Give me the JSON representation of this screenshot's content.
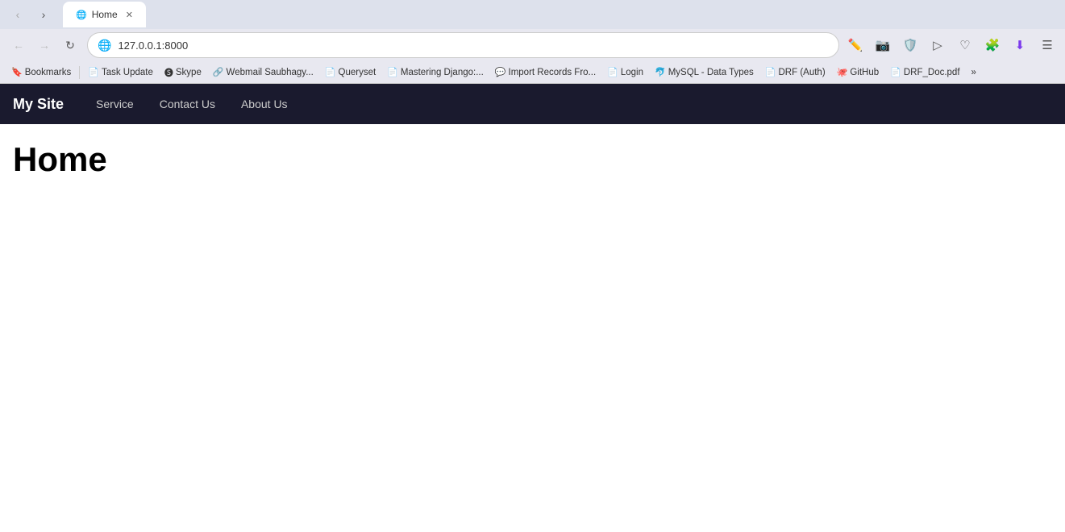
{
  "browser": {
    "tab_title": "Home",
    "tab_favicon": "🌐",
    "address": "127.0.0.1:8000",
    "back_btn": "←",
    "forward_btn": "→",
    "reload_btn": "↻",
    "menu_btn": "⋮"
  },
  "bookmarks": [
    {
      "label": "Bookmarks",
      "icon": "🔖",
      "id": "bookmarks"
    },
    {
      "label": "Task Update",
      "icon": "📄",
      "id": "task-update"
    },
    {
      "label": "Skype",
      "icon": "🅢",
      "id": "skype",
      "brand": true
    },
    {
      "label": "Webmail Saubhagy...",
      "icon": "🔗",
      "id": "webmail"
    },
    {
      "label": "Queryset",
      "icon": "📄",
      "id": "queryset"
    },
    {
      "label": "Mastering Django:...",
      "icon": "📄",
      "id": "mastering-django"
    },
    {
      "label": "Import Records Fro...",
      "icon": "💬",
      "id": "import-records"
    },
    {
      "label": "Login",
      "icon": "📄",
      "id": "login"
    },
    {
      "label": "MySQL - Data Types",
      "icon": "🐬",
      "id": "mysql"
    },
    {
      "label": "DRF (Auth)",
      "icon": "📄",
      "id": "drf-auth"
    },
    {
      "label": "GitHub",
      "icon": "🐙",
      "id": "github"
    },
    {
      "label": "DRF_Doc.pdf",
      "icon": "📄",
      "id": "drf-doc"
    },
    {
      "label": "»",
      "icon": "",
      "id": "more"
    }
  ],
  "toolbar_icons": [
    {
      "icon": "✏️",
      "name": "screenshot-icon"
    },
    {
      "icon": "📷",
      "name": "camera-icon"
    },
    {
      "icon": "🛡️",
      "name": "shield-icon",
      "color": "purple"
    },
    {
      "icon": "▷",
      "name": "play-icon"
    },
    {
      "icon": "♡",
      "name": "heart-icon"
    },
    {
      "icon": "🧩",
      "name": "puzzle-icon"
    },
    {
      "icon": "⬇️",
      "name": "download-icon",
      "color": "purple"
    },
    {
      "icon": "☰",
      "name": "menu-icon"
    }
  ],
  "site": {
    "logo": "My Site",
    "nav_links": [
      {
        "label": "Service",
        "id": "nav-service"
      },
      {
        "label": "Contact Us",
        "id": "nav-contact"
      },
      {
        "label": "About Us",
        "id": "nav-about"
      }
    ]
  },
  "page": {
    "heading": "Home"
  }
}
